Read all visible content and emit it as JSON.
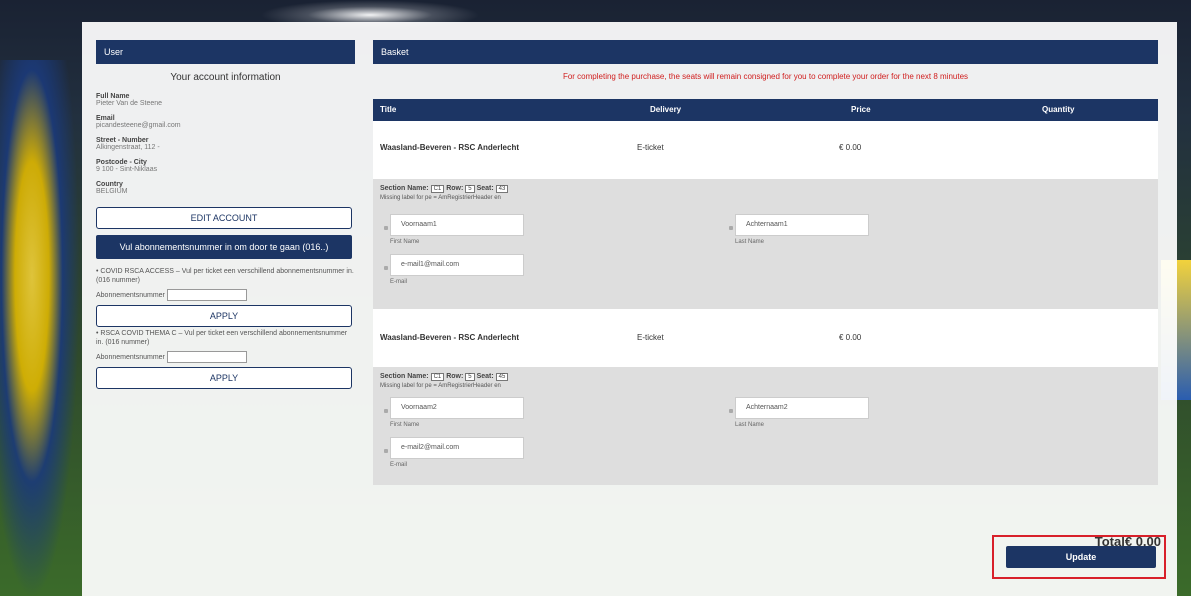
{
  "user": {
    "header": "User",
    "title": "Your account information",
    "fields": [
      {
        "label": "Full Name",
        "value": "Pieter Van de Steene"
      },
      {
        "label": "Email",
        "value": "picandesteene@gmail.com"
      },
      {
        "label": "Street - Number",
        "value": "Alkingenstraat, 112 -"
      },
      {
        "label": "Postcode - City",
        "value": "9 100 - Sint-Niklaas"
      },
      {
        "label": "Country",
        "value": "BELGIUM"
      }
    ],
    "edit_label": "EDIT ACCOUNT",
    "subscription_label": "Vul abonnementsnummer in om door te gaan (016..)",
    "promo1": {
      "text": "• COVID RSCA ACCESS – Vul per ticket een verschillend abonnementsnummer in. (016 nummer)",
      "input_label": "Abonnementsnummer",
      "apply": "APPLY"
    },
    "promo2": {
      "text": "• RSCA COVID THEMA C – Vul per ticket een verschillend abonnementsnummer in. (016 nummer)",
      "input_label": "Abonnementsnummer",
      "apply": "APPLY"
    }
  },
  "basket": {
    "header": "Basket",
    "notice": "For completing the purchase, the seats will remain consigned for you to complete your order for the next 8 minutes",
    "columns": [
      "Title",
      "Delivery",
      "Price",
      "Quantity"
    ],
    "items": [
      {
        "title": "Waasland-Beveren - RSC Anderlecht",
        "delivery": "E-ticket",
        "price": "€ 0.00",
        "section_label": "Section Name:",
        "section": "C1",
        "row_label": "Row:",
        "row": "5",
        "seat_label": "Seat:",
        "seat": "43",
        "missing": "Missing label for pe = AmRegistrierHeader en",
        "first_name": "Voornaam1",
        "first_name_label": "First Name",
        "last_name": "Achternaam1",
        "last_name_label": "Last Name",
        "email": "e-mail1@mail.com",
        "email_label": "E-mail"
      },
      {
        "title": "Waasland-Beveren - RSC Anderlecht",
        "delivery": "E-ticket",
        "price": "€ 0.00",
        "section_label": "Section Name:",
        "section": "C1",
        "row_label": "Row:",
        "row": "5",
        "seat_label": "Seat:",
        "seat": "45",
        "missing": "Missing label for pe = AmRegistrierHeader en",
        "first_name": "Voornaam2",
        "first_name_label": "First Name",
        "last_name": "Achternaam2",
        "last_name_label": "Last Name",
        "email": "e-mail2@mail.com",
        "email_label": "E-mail"
      }
    ],
    "total": "Total€ 0.00",
    "update": "Update"
  }
}
